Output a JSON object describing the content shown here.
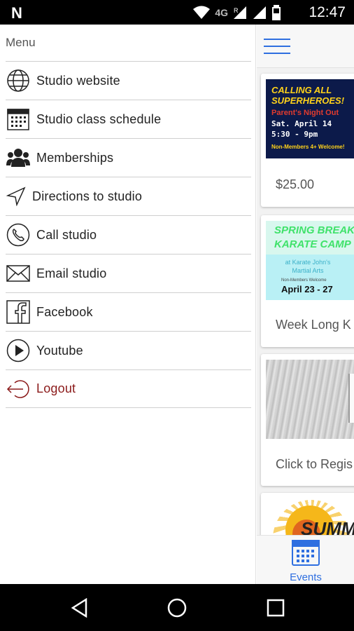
{
  "status_bar": {
    "carrier_logo": "N",
    "network": "4G",
    "roaming": "R",
    "time": "12:47"
  },
  "drawer": {
    "title": "Menu",
    "items": [
      {
        "label": "Studio website",
        "icon": "globe-icon"
      },
      {
        "label": "Studio class schedule",
        "icon": "calendar-icon"
      },
      {
        "label": "Memberships",
        "icon": "users-icon"
      },
      {
        "label": "Directions to studio",
        "icon": "navigation-arrow-icon"
      },
      {
        "label": "Call studio",
        "icon": "phone-icon"
      },
      {
        "label": "Email studio",
        "icon": "envelope-icon"
      },
      {
        "label": "Facebook",
        "icon": "facebook-icon"
      },
      {
        "label": "Youtube",
        "icon": "play-icon"
      },
      {
        "label": "Logout",
        "icon": "logout-icon"
      }
    ]
  },
  "events": [
    {
      "caption": "$25.00",
      "poster": {
        "line1": "CALLING ALL",
        "line2": "SUPERHEROES!",
        "line3": "Parent's Night Out",
        "line4": "Sat. April 14",
        "line5": "5:30 - 9pm",
        "line6": "Non-Members 4+ Welcome!"
      }
    },
    {
      "caption": "Week Long K",
      "poster": {
        "line1": "SPRING BREAK",
        "line2": "KARATE CAMP",
        "line3": "at Karate John's Martial Arts",
        "line4": "Non-Members Welcome",
        "line5": "April 23 - 27"
      }
    },
    {
      "caption": "Click to Regis"
    },
    {
      "poster": {
        "text": "SUMME"
      }
    }
  ],
  "bottom_tab": {
    "label": "Events"
  },
  "colors": {
    "accent": "#2f6fe0",
    "logout": "#8b1a1a",
    "status_bar": "#000000"
  }
}
